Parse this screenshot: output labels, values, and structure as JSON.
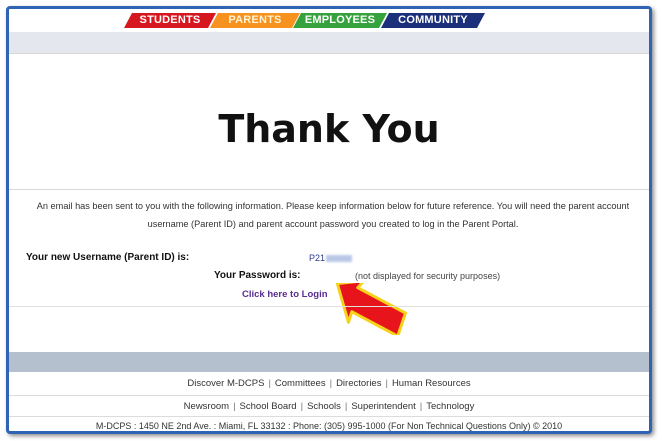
{
  "nav": {
    "tabs": [
      {
        "label": "STUDENTS"
      },
      {
        "label": "PARENTS"
      },
      {
        "label": "EMPLOYEES"
      },
      {
        "label": "COMMUNITY"
      }
    ]
  },
  "main": {
    "title": "Thank You",
    "info_line1": "An email has been sent to you with the following information. Please keep information below for future reference. You will need the parent account",
    "info_line2": "username (Parent ID) and parent account password you created to log in the Parent Portal.",
    "username_label": "Your new Username (Parent ID) is:",
    "username_value": "P21",
    "password_label": "Your Password is:",
    "password_value": "(not displayed for security purposes)",
    "login_link": "Click here to Login"
  },
  "footer": {
    "row1": [
      "Discover M-DCPS",
      "Committees",
      "Directories",
      "Human Resources"
    ],
    "row2": [
      "Newsroom",
      "School Board",
      "Schools",
      "Superintendent",
      "Technology"
    ],
    "copyright": "M-DCPS : 1450 NE 2nd Ave. : Miami, FL 33132 : Phone: (305) 995-1000 (For Non Technical Questions Only) © 2010"
  },
  "colors": {
    "students": "#d7171f",
    "parents": "#f7921e",
    "employees": "#36a23e",
    "community": "#1b2f7a",
    "arrow_fill": "#e8141c",
    "arrow_outline": "#f6d31a"
  }
}
